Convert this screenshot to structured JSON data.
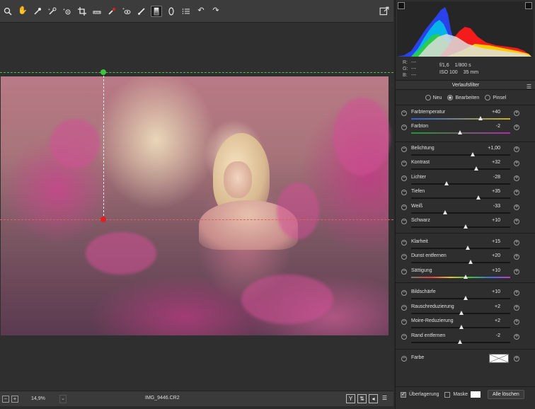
{
  "toolbar": {
    "tools": [
      "zoom-icon",
      "hand-icon",
      "white-balance-icon",
      "color-sampler-icon",
      "target-adjust-icon",
      "crop-icon",
      "straighten-icon",
      "spot-removal-icon",
      "red-eye-icon",
      "adjustment-brush-icon",
      "graduated-filter-icon",
      "radial-filter-icon",
      "preferences-icon",
      "rotate-left-icon",
      "rotate-right-icon"
    ],
    "active_tool": "graduated-filter-icon"
  },
  "status": {
    "zoom": "14,9%",
    "filename": "IMG_9446.CR2",
    "view_mode": "Y"
  },
  "histogram": {
    "rgb": [
      {
        "channel": "R:",
        "value": "---"
      },
      {
        "channel": "G:",
        "value": "---"
      },
      {
        "channel": "B:",
        "value": "---"
      }
    ],
    "aperture": "f/1,6",
    "shutter": "1/800 s",
    "iso": "ISO 100",
    "focal": "35 mm"
  },
  "panel": {
    "title": "Verlaufsfilter",
    "modes": [
      {
        "label": "Neu",
        "selected": false
      },
      {
        "label": "Bearbeiten",
        "selected": true
      },
      {
        "label": "Pinsel",
        "selected": false
      }
    ]
  },
  "sliders": [
    {
      "label": "Farbtemperatur",
      "value": "+40",
      "position": 0.7,
      "gradient": "temp"
    },
    {
      "label": "Farbton",
      "value": "-2",
      "position": 0.49,
      "gradient": "tint"
    },
    {
      "label": "Belichtung",
      "value": "+1,00",
      "position": 0.62,
      "gradient": "gray"
    },
    {
      "label": "Kontrast",
      "value": "+32",
      "position": 0.66,
      "gradient": "gray"
    },
    {
      "label": "Lichter",
      "value": "-28",
      "position": 0.36,
      "gradient": "gray"
    },
    {
      "label": "Tiefen",
      "value": "+35",
      "position": 0.68,
      "gradient": "gray"
    },
    {
      "label": "Weiß",
      "value": "-33",
      "position": 0.34,
      "gradient": "gray"
    },
    {
      "label": "Schwarz",
      "value": "+10",
      "position": 0.55,
      "gradient": "gray"
    },
    {
      "label": "Klarheit",
      "value": "+15",
      "position": 0.57,
      "gradient": "gray"
    },
    {
      "label": "Dunst entfernen",
      "value": "+20",
      "position": 0.6,
      "gradient": "gray"
    },
    {
      "label": "Sättigung",
      "value": "+10",
      "position": 0.55,
      "gradient": "sat"
    },
    {
      "label": "Bildschärfe",
      "value": "+10",
      "position": 0.55,
      "gradient": "gray"
    },
    {
      "label": "Rauschreduzierung",
      "value": "+2",
      "position": 0.51,
      "gradient": "gray"
    },
    {
      "label": "Moire-Reduzierung",
      "value": "+2",
      "position": 0.51,
      "gradient": "gray"
    },
    {
      "label": "Rand entfernen",
      "value": "-2",
      "position": 0.49,
      "gradient": "gray"
    }
  ],
  "farbe": {
    "label": "Farbe"
  },
  "bottom": {
    "overlay_label": "Überlagerung",
    "overlay_checked": true,
    "mask_label": "Maske",
    "mask_checked": false,
    "clear_label": "Alle löschen"
  }
}
